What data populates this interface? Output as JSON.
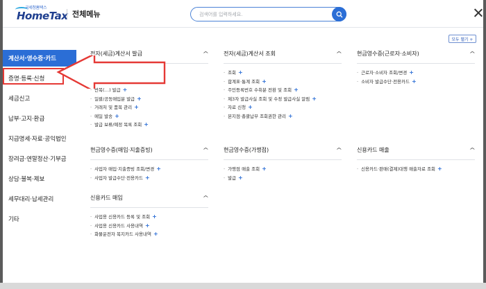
{
  "header": {
    "logo_small": "국세청홈택스",
    "logo_big": "HomeTax",
    "title": "전체메뉴",
    "search_placeholder": "검색어를 입력하세요.",
    "expand_all": "모두 펼기 +"
  },
  "sidebar": {
    "items": [
      {
        "label": "계산서·영수증·카드",
        "active": true
      },
      {
        "label": "증명·등록·신청",
        "active": false
      },
      {
        "label": "세금신고",
        "active": false
      },
      {
        "label": "납부·고지·환급",
        "active": false
      },
      {
        "label": "지급명세·자료·공익법인",
        "active": false
      },
      {
        "label": "장려금·연말정산·기부금",
        "active": false
      },
      {
        "label": "상담·불복·제보",
        "active": false
      },
      {
        "label": "세무대리·납세관리",
        "active": false
      },
      {
        "label": "기타",
        "active": false
      }
    ]
  },
  "columns": [
    {
      "title": "전자(세금)계산서 발급",
      "items": [
        {
          "label": "",
          "plus": false
        },
        {
          "label": "",
          "plus": false
        },
        {
          "label": "반복(…) 발급",
          "plus": true
        },
        {
          "label": "일괄/공동매입분 발급",
          "plus": true
        },
        {
          "label": "거래처 및 품목 관리",
          "plus": true
        },
        {
          "label": "메일 발송",
          "plus": true
        },
        {
          "label": "발급 보류/예정 목록 조회",
          "plus": true
        }
      ]
    },
    {
      "title": "전자(세금)계산서 조회",
      "items": [
        {
          "label": "조회",
          "plus": true
        },
        {
          "label": "합계표·통계 조회",
          "plus": true
        },
        {
          "label": "주민등록번호 수취분 전환 및 조회",
          "plus": true
        },
        {
          "label": "제3자 발급사실 조회 및 수정 발급사실 알림",
          "plus": true
        },
        {
          "label": "자료 신청",
          "plus": true
        },
        {
          "label": "본지점·총괄납부 조회권한 관리",
          "plus": true
        }
      ]
    },
    {
      "title": "현금영수증(근로자·소비자)",
      "items": [
        {
          "label": "근로자·소비자 조회/변경",
          "plus": true
        },
        {
          "label": "소비자 발급수단·전용카드",
          "plus": true
        }
      ]
    },
    {
      "title": "현금영수증(매입·지출증빙)",
      "items": [
        {
          "label": "사업자 매입·지출증빙 조회/변경",
          "plus": true
        },
        {
          "label": "사업자 발급수단·전용카드",
          "plus": true
        }
      ]
    },
    {
      "title": "현금영수증(가맹점)",
      "items": [
        {
          "label": "가맹점 매출 조회",
          "plus": true
        },
        {
          "label": "발급",
          "plus": true
        }
      ]
    },
    {
      "title": "신용카드 매출",
      "items": [
        {
          "label": "신용카드·판매(결제)대행 매출자료 조회",
          "plus": true
        }
      ]
    },
    {
      "title": "신용카드 매입",
      "items": [
        {
          "label": "사업용 신용카드 등록 및 조회",
          "plus": true
        },
        {
          "label": "사업용 신용카드 사용내역",
          "plus": true
        },
        {
          "label": "화물운전자 복지카드 사용내역",
          "plus": true
        }
      ]
    }
  ],
  "colors": {
    "accent": "#2b6ed6",
    "annotation": "#e53935"
  }
}
